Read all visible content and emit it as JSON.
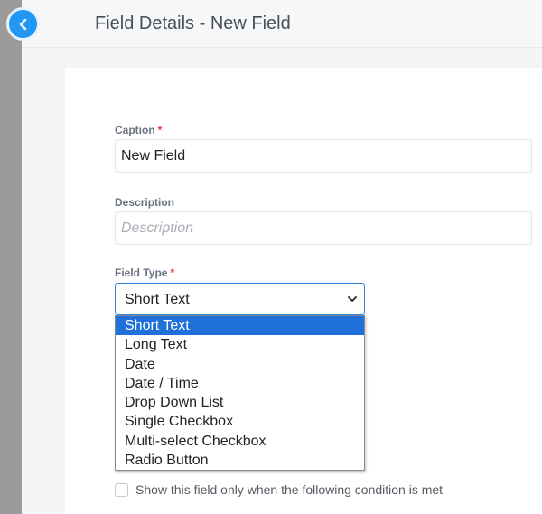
{
  "header": {
    "title": "Field Details - New Field",
    "back_icon": "chevron-left-icon",
    "accent": "#2196f3"
  },
  "form": {
    "caption": {
      "label": "Caption",
      "required_mark": "*",
      "value": "New Field"
    },
    "description": {
      "label": "Description",
      "placeholder": "Description",
      "value": ""
    },
    "field_type": {
      "label": "Field Type",
      "required_mark": "*",
      "selected": "Short Text",
      "options": [
        "Short Text",
        "Long Text",
        "Date",
        "Date / Time",
        "Drop Down List",
        "Single Checkbox",
        "Multi-select Checkbox",
        "Radio Button"
      ]
    },
    "condition": {
      "label": "Show this field only when the following condition is met",
      "checked": false
    }
  }
}
